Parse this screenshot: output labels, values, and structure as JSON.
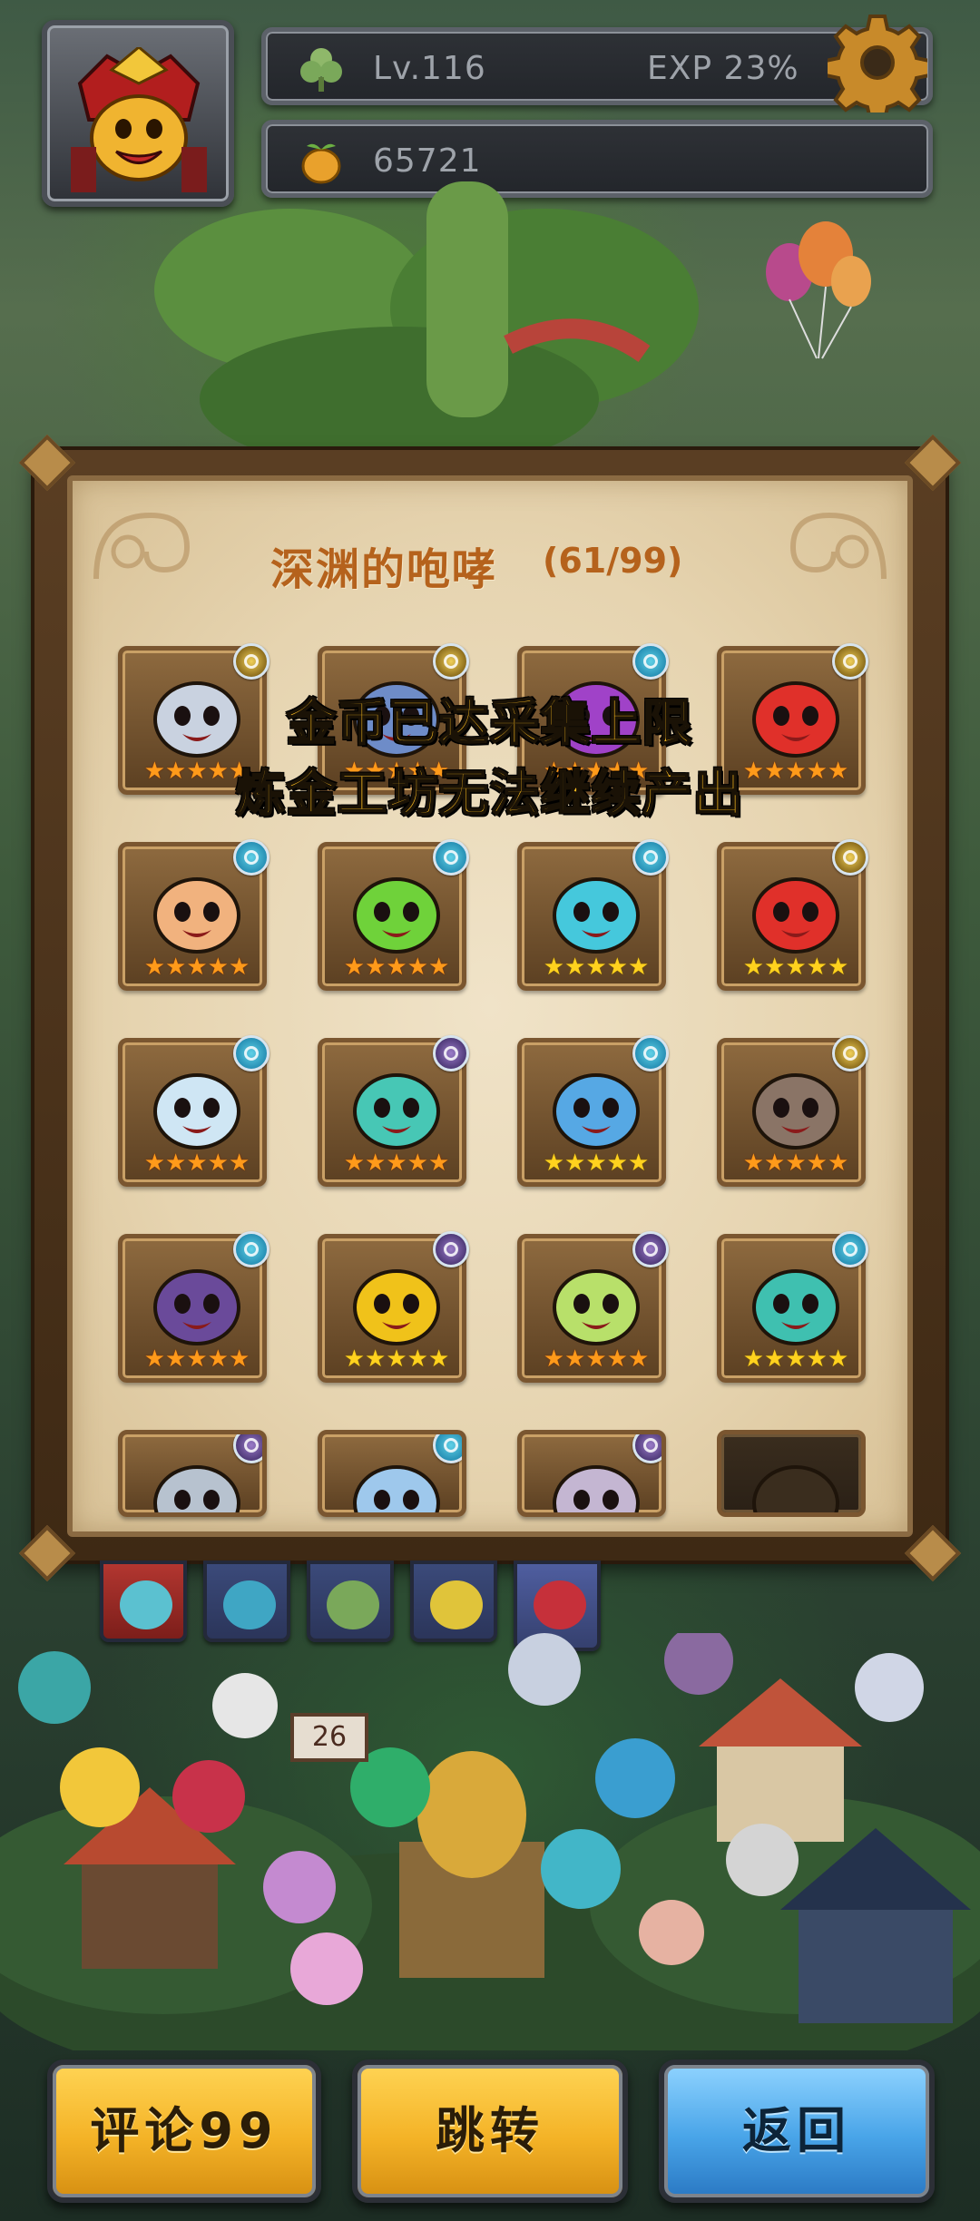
{
  "hud": {
    "level_label": "Lv.116",
    "exp_label": "EXP 23%",
    "coins": "65721"
  },
  "panel": {
    "title": "深渊的咆哮",
    "count": "(61/99)"
  },
  "toast": {
    "line1": "金币已达采集上限",
    "line2": "炼金工坊无法继续产出"
  },
  "cards": [
    {
      "stars": "★★★★★",
      "color": "#c9d2e0",
      "badge": "gold",
      "star_color": "orange"
    },
    {
      "stars": "★★★★★",
      "color": "#6e8cc8",
      "badge": "gold",
      "star_color": "orange"
    },
    {
      "stars": "★★★★★",
      "color": "#a042c8",
      "badge": "blue",
      "star_color": "orange"
    },
    {
      "stars": "★★★★★",
      "color": "#e0302a",
      "badge": "gold",
      "star_color": "orange"
    },
    {
      "stars": "★★★★★",
      "color": "#f1b27e",
      "badge": "blue",
      "star_color": "orange"
    },
    {
      "stars": "★★★★★",
      "color": "#6fd23a",
      "badge": "blue",
      "star_color": "orange"
    },
    {
      "stars": "★★★★★",
      "color": "#45c8dc",
      "badge": "blue",
      "star_color": "gold"
    },
    {
      "stars": "★★★★★",
      "color": "#e0302a",
      "badge": "gold",
      "star_color": "gold"
    },
    {
      "stars": "★★★★★",
      "color": "#cfe6f4",
      "badge": "blue",
      "star_color": "orange"
    },
    {
      "stars": "★★★★★",
      "color": "#47c7b5",
      "badge": "purple",
      "star_color": "orange"
    },
    {
      "stars": "★★★★★",
      "color": "#56a8e4",
      "badge": "blue",
      "star_color": "gold"
    },
    {
      "stars": "★★★★★",
      "color": "#8a7466",
      "badge": "gold",
      "star_color": "orange"
    },
    {
      "stars": "★★★★★",
      "color": "#6a4a9a",
      "badge": "blue",
      "star_color": "orange"
    },
    {
      "stars": "★★★★★",
      "color": "#f0c21a",
      "badge": "purple",
      "star_color": "gold"
    },
    {
      "stars": "★★★★★",
      "color": "#b8e06a",
      "badge": "purple",
      "star_color": "orange"
    },
    {
      "stars": "★★★★★",
      "color": "#3fc0b0",
      "badge": "blue",
      "star_color": "gold"
    },
    {
      "stars": "",
      "color": "#b7c2cf",
      "badge": "purple",
      "star_color": "orange"
    },
    {
      "stars": "",
      "color": "#9ec8ec",
      "badge": "blue",
      "star_color": "orange"
    },
    {
      "stars": "",
      "color": "#c4b6d2",
      "badge": "purple",
      "star_color": "orange"
    },
    {
      "stars": "",
      "color": "#3a2d1e",
      "badge": "none",
      "star_color": "orange"
    }
  ],
  "buttons": {
    "comment": "评论99",
    "jump": "跳转",
    "back": "返回"
  },
  "village": {
    "sign_number": "26"
  },
  "colors": {
    "button_gold": "#f4b327",
    "button_blue": "#48a4e8",
    "title": "#b5621c",
    "toast": "#ffbe1f",
    "panel_parchment": "#e6d4b0"
  }
}
